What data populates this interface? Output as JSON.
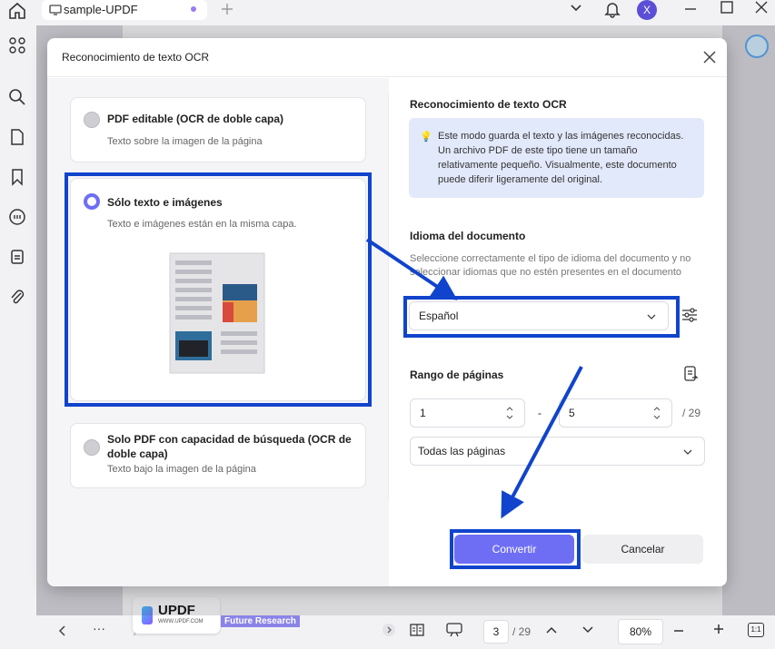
{
  "tab": {
    "title": "sample-UPDF"
  },
  "avatar": {
    "initial": "X"
  },
  "dialog": {
    "title": "Reconocimiento de texto OCR",
    "options": [
      {
        "title": "PDF editable (OCR de doble capa)",
        "subtitle": "Texto sobre la imagen de la página",
        "selected": false
      },
      {
        "title": "Sólo texto e imágenes",
        "subtitle": "Texto e imágenes están en la misma capa.",
        "selected": true
      },
      {
        "title": "Solo PDF con capacidad de búsqueda (OCR de doble capa)",
        "subtitle": "Texto bajo la imagen de la página",
        "selected": false
      }
    ],
    "info": {
      "title": "Reconocimiento de texto OCR",
      "text": "Este modo guarda el texto y las imágenes reconocidas. Un archivo PDF de este tipo tiene un tamaño relativamente pequeño. Visualmente, este documento puede diferir ligeramente del original."
    },
    "language": {
      "label": "Idioma del documento",
      "hint": "Seleccione correctamente el tipo de idioma del documento y no seleccionar idiomas que no estén presentes en el documento",
      "value": "Español"
    },
    "range": {
      "label": "Rango de páginas",
      "from": "1",
      "dash": "-",
      "to": "5",
      "total": "/ 29",
      "subset": "Todas las páginas"
    },
    "convert_label": "Convertir",
    "cancel_label": "Cancelar"
  },
  "bottombar": {
    "page_current": "3",
    "page_total": "/ 29",
    "zoom": "80%",
    "brand": "UPDF",
    "brand_url": "WWW.UPDF.COM",
    "doc_label": "Future Research",
    "fit_label": "1:1"
  },
  "colors": {
    "accent": "#6e6ef5",
    "annotation": "#1144cc",
    "info_bg": "#e2e9fb"
  }
}
